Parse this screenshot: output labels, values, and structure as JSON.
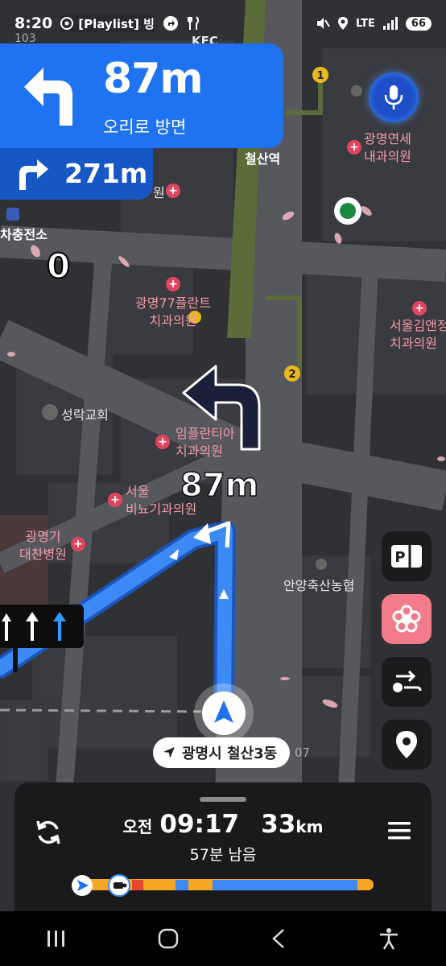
{
  "status_bar": {
    "time": "8:20",
    "media_pill": "[Playlist] 빙",
    "network": "LTE",
    "battery": "66"
  },
  "guidance": {
    "distance": "87m",
    "direction": "오리로 방면",
    "next_distance": "271m",
    "map_distance": "87m",
    "speed": "0"
  },
  "map": {
    "labels": {
      "station": "철산역",
      "kfc": "KFC",
      "num_103": "103",
      "clinic_yonsei": "광명연세\n내과의원",
      "charging": "차충전소",
      "clinic_77": "광명77플란트\n치과의원",
      "clinic_seoul_kim": "서울김앤정\n치과의원",
      "church": "성락교회",
      "implant_clinic": "임플란티아\n치과의원",
      "seoul_clinic": "서울\n비뇨기과의원",
      "hospital": "광명기\n대찬병원",
      "nonghyup": "안양축산농협",
      "fragment_won": "원",
      "num_07": "07",
      "marker_1": "1",
      "marker_2": "2"
    }
  },
  "location_chip": "광명시 철산3동",
  "trip": {
    "eta_prefix": "오전",
    "eta_time": "09:17",
    "distance_value": "33",
    "distance_unit": "km",
    "remaining": "57분 남음"
  },
  "colors": {
    "primary_blue": "#1f72f0",
    "route_blue": "#3d8af7",
    "traffic_orange": "#f5a623",
    "traffic_red": "#e8452c",
    "pink_button": "#f37b8a"
  }
}
